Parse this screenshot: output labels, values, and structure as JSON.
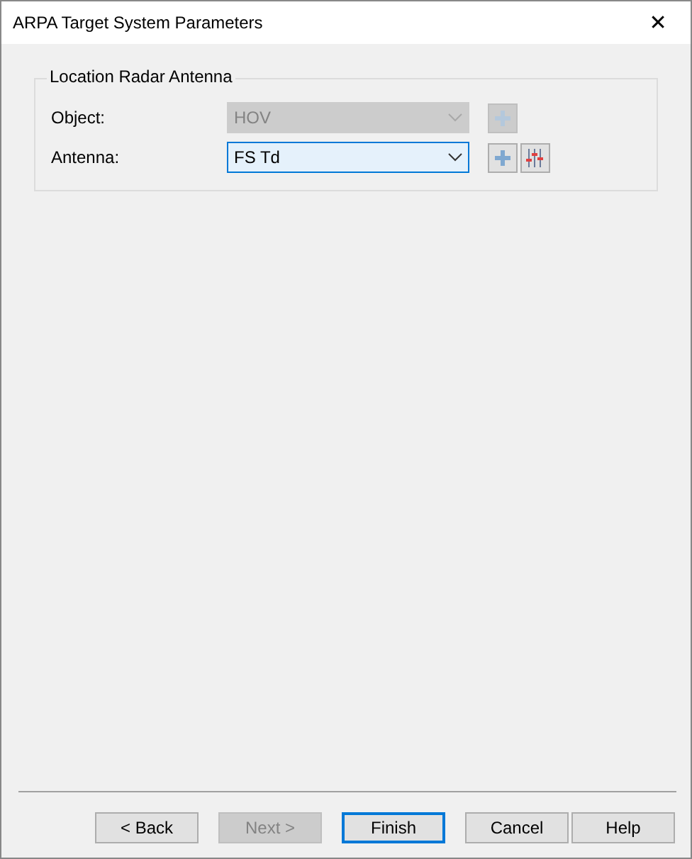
{
  "window": {
    "title": "ARPA Target System Parameters",
    "close": "✕"
  },
  "group": {
    "title": "Location Radar Antenna",
    "rows": [
      {
        "label": "Object:",
        "value": "HOV",
        "disabled": true,
        "settings_button": false
      },
      {
        "label": "Antenna:",
        "value": "FS Td",
        "disabled": false,
        "settings_button": true
      }
    ]
  },
  "buttons": [
    {
      "label": "< Back",
      "disabled": false,
      "default": false
    },
    {
      "label": "Next >",
      "disabled": true,
      "default": false
    },
    {
      "label": "Finish",
      "disabled": false,
      "default": true
    },
    {
      "label": "Cancel",
      "disabled": false,
      "default": false
    },
    {
      "label": "Help",
      "disabled": false,
      "default": false
    }
  ]
}
